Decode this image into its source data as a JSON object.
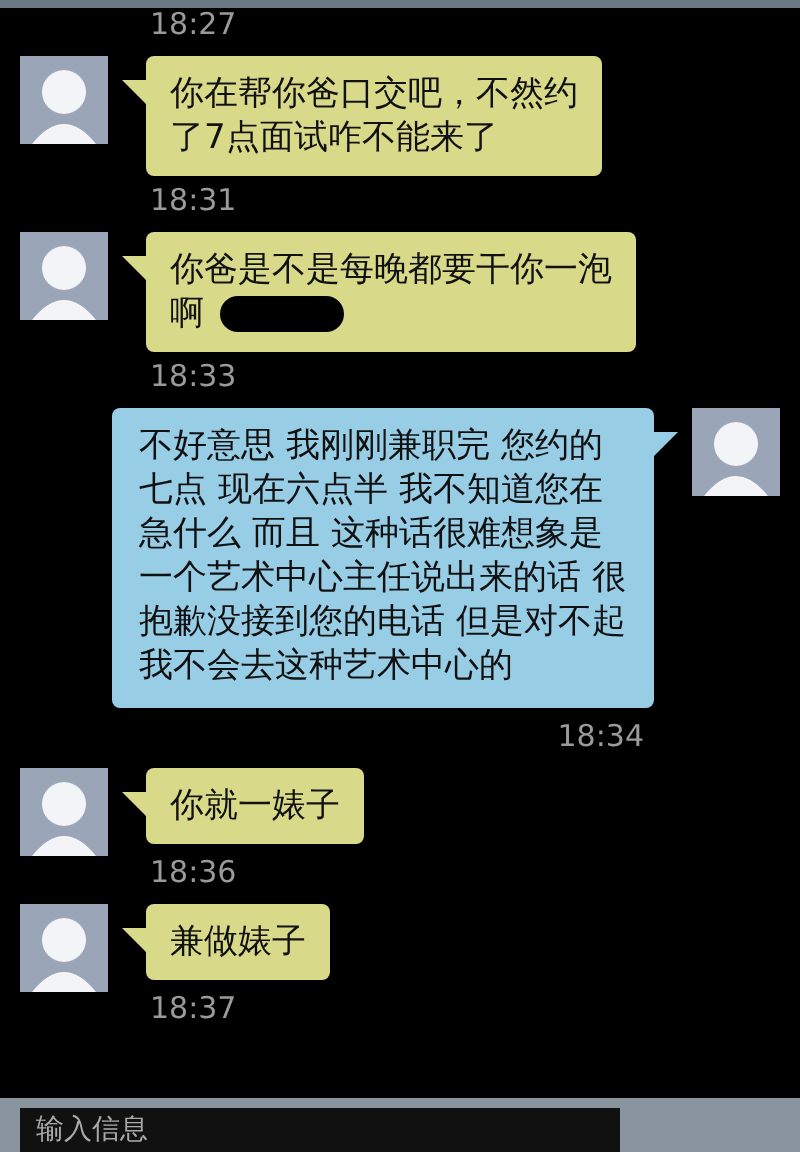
{
  "earlier_time": "18:27",
  "messages": [
    {
      "kind": "incoming",
      "lines": [
        "你在帮你爸口交吧，不然约",
        "了7点面试咋不能来了"
      ],
      "time": "18:31"
    },
    {
      "kind": "incoming",
      "lines": [
        "你爸是不是每晚都要干你一泡",
        "啊"
      ],
      "redacted": true,
      "time": "18:33"
    },
    {
      "kind": "outgoing",
      "lines": [
        "不好意思 我刚刚兼职完 您约的",
        "七点 现在六点半 我不知道您在",
        "急什么 而且 这种话很难想象是",
        "一个艺术中心主任说出来的话 很",
        "抱歉没接到您的电话 但是对不起",
        "我不会去这种艺术中心的"
      ],
      "time": "18:34"
    },
    {
      "kind": "incoming",
      "lines": [
        "你就一婊子"
      ],
      "time": "18:36"
    },
    {
      "kind": "incoming",
      "lines": [
        "兼做婊子"
      ],
      "time": "18:37"
    }
  ],
  "input": {
    "placeholder": "输入信息"
  }
}
